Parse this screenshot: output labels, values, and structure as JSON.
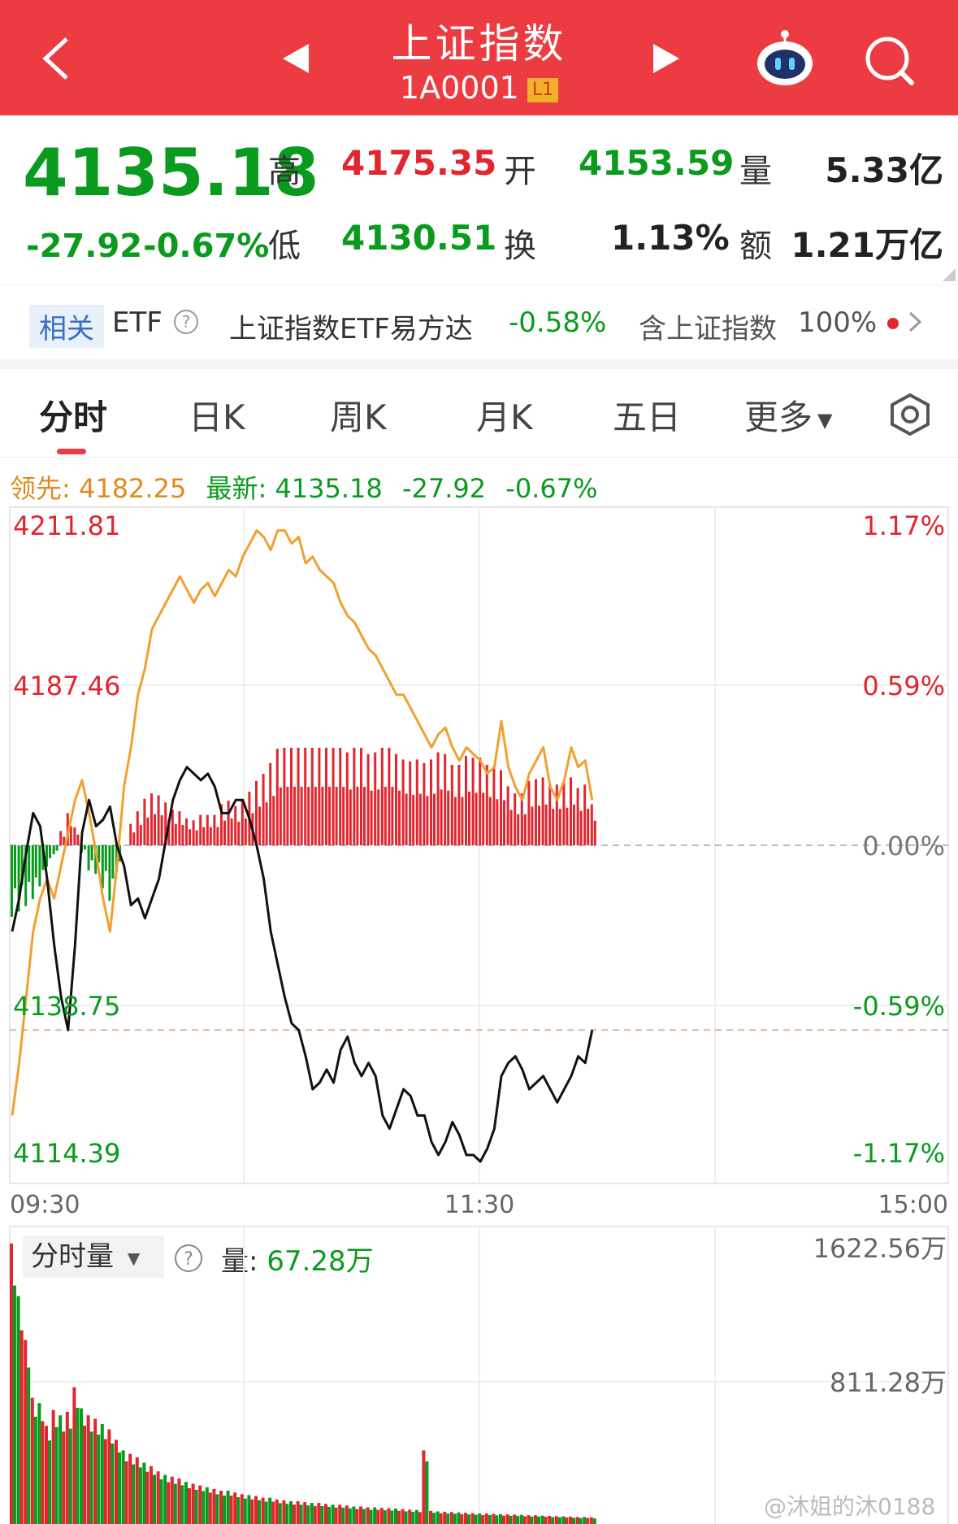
{
  "header": {
    "title": "上证指数",
    "code": "1A0001",
    "level_badge": "L1"
  },
  "quote": {
    "price": "4135.18",
    "change": "-27.92",
    "change_pct": "-0.67%",
    "high_label": "高",
    "high": "4175.35",
    "low_label": "低",
    "low": "4130.51",
    "open_label": "开",
    "open": "4153.59",
    "turnover_label": "换",
    "turnover": "1.13%",
    "volume_label": "量",
    "volume": "5.33亿",
    "amount_label": "额",
    "amount": "1.21万亿"
  },
  "etf": {
    "tag": "相关",
    "etf_label": "ETF",
    "etf_name": "上证指数ETF易方达",
    "etf_change": "-0.58%",
    "contains": "含上证指数",
    "weight": "100%"
  },
  "tabs": [
    "分时",
    "日K",
    "周K",
    "月K",
    "五日",
    "更多"
  ],
  "legend": {
    "leading_label": "领先:",
    "leading_value": "4182.25",
    "latest_label": "最新:",
    "latest_value": "4135.18",
    "latest_change": "-27.92",
    "latest_pct": "-0.67%"
  },
  "colors": {
    "up": "#e0262e",
    "down": "#0a9a1e",
    "leading_line": "#f0a030",
    "price_line": "#111111",
    "header_bg": "#ec3b41"
  },
  "chart_data": [
    {
      "type": "line",
      "y_ticks_left": [
        "4211.81",
        "4187.46",
        "4138.75",
        "4114.39"
      ],
      "y_ticks_right": [
        "1.17%",
        "0.59%",
        "0.00%",
        "-0.59%",
        "-1.17%"
      ],
      "x_ticks": [
        "09:30",
        "11:30",
        "15:00"
      ],
      "ylim": [
        4114.39,
        4211.81
      ],
      "prev_close": 4163.1,
      "series": [
        {
          "name": "领先",
          "values": [
            4122,
            4130,
            4140,
            4150,
            4155,
            4158,
            4155,
            4160,
            4165,
            4170,
            4173,
            4168,
            4162,
            4155,
            4150,
            4160,
            4172,
            4178,
            4186,
            4190,
            4196,
            4198,
            4200,
            4202,
            4204,
            4202,
            4200,
            4202,
            4203,
            4201,
            4203,
            4205,
            4204,
            4207,
            4209,
            4211,
            4210,
            4208,
            4211,
            4211,
            4209,
            4210,
            4206,
            4207,
            4205,
            4204,
            4203,
            4200,
            4198,
            4197,
            4195,
            4193,
            4192,
            4190,
            4188,
            4186,
            4186,
            4184,
            4182,
            4180,
            4178,
            4180,
            4181,
            4178,
            4176,
            4178,
            4177,
            4176,
            4174,
            4175,
            4182,
            4175,
            4172,
            4170,
            4174,
            4176,
            4178,
            4172,
            4170,
            4173,
            4178,
            4175,
            4176,
            4170
          ]
        },
        {
          "name": "最新",
          "values": [
            4150,
            4155,
            4162,
            4168,
            4166,
            4158,
            4148,
            4140,
            4135,
            4148,
            4165,
            4170,
            4166,
            4167,
            4169,
            4163,
            4160,
            4154,
            4155,
            4152,
            4155,
            4158,
            4164,
            4170,
            4173,
            4175,
            4174,
            4173,
            4174,
            4172,
            4168,
            4168,
            4170,
            4170,
            4167,
            4163,
            4158,
            4150,
            4145,
            4140,
            4136,
            4135,
            4131,
            4126,
            4127,
            4129,
            4127,
            4132,
            4134,
            4130,
            4128,
            4130,
            4128,
            4122,
            4120,
            4123,
            4126,
            4125,
            4122,
            4122,
            4118,
            4116,
            4118,
            4121,
            4119,
            4116,
            4116,
            4115,
            4117,
            4120,
            4128,
            4130,
            4131,
            4129,
            4126,
            4127,
            4128,
            4126,
            4124,
            4126,
            4128,
            4131,
            4130,
            4135
          ]
        }
      ]
    },
    {
      "type": "bar",
      "name": "分时量",
      "selector_label": "分时量",
      "volume_label": "量:",
      "volume_value": "67.28万",
      "y_ticks": [
        "1622.56万",
        "811.28万"
      ],
      "ylim": [
        0,
        1622.56
      ],
      "values": [
        1600,
        1300,
        1050,
        720,
        690,
        560,
        650,
        620,
        640,
        780,
        660,
        620,
        600,
        570,
        540,
        480,
        420,
        400,
        380,
        350,
        330,
        300,
        280,
        270,
        260,
        240,
        230,
        220,
        210,
        200,
        190,
        190,
        180,
        170,
        165,
        160,
        150,
        150,
        140,
        135,
        130,
        130,
        125,
        120,
        120,
        115,
        110,
        110,
        105,
        100,
        100,
        95,
        95,
        92,
        90,
        88,
        85,
        82,
        80,
        420,
        75,
        72,
        70,
        68,
        66,
        64,
        62,
        60,
        60,
        58,
        56,
        55,
        54,
        52,
        50,
        50,
        48,
        46,
        45,
        44,
        42,
        40,
        40,
        38
      ]
    }
  ],
  "watermark": "@沐姐的沐0188"
}
